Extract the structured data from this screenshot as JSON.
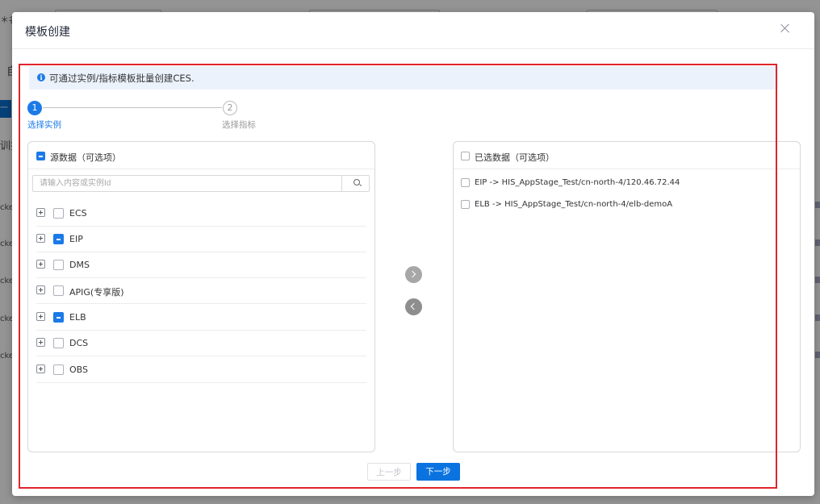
{
  "background": {
    "fragments": [
      "＊名",
      "自",
      "一键",
      "训指",
      "cketF",
      "cketF",
      "cketF",
      "cketF",
      "cketF"
    ]
  },
  "modal": {
    "title": "模板创建",
    "info_text": "可通过实例/指标模板批量创建CES.",
    "steps": [
      {
        "number": "1",
        "label": "选择实例",
        "active": true
      },
      {
        "number": "2",
        "label": "选择指标",
        "active": false
      }
    ],
    "source": {
      "title": "源数据（可选项）",
      "search_placeholder": "请输入内容或实例Id",
      "items": [
        {
          "label": "ECS",
          "state": "unchecked"
        },
        {
          "label": "EIP",
          "state": "partial"
        },
        {
          "label": "DMS",
          "state": "unchecked"
        },
        {
          "label": "APIG(专享版)",
          "state": "unchecked"
        },
        {
          "label": "ELB",
          "state": "partial"
        },
        {
          "label": "DCS",
          "state": "unchecked"
        },
        {
          "label": "OBS",
          "state": "unchecked"
        }
      ]
    },
    "target": {
      "title": "已选数据（可选项）",
      "items": [
        {
          "label": "EIP -> HIS_AppStage_Test/cn-north-4/120.46.72.44"
        },
        {
          "label": "ELB -> HIS_AppStage_Test/cn-north-4/elb-demoA"
        }
      ]
    },
    "buttons": {
      "prev": "上一步",
      "next": "下一步"
    }
  },
  "colors": {
    "primary": "#1b7ae8",
    "highlight": "#e0252b",
    "info_bg": "#ebf2fc"
  }
}
